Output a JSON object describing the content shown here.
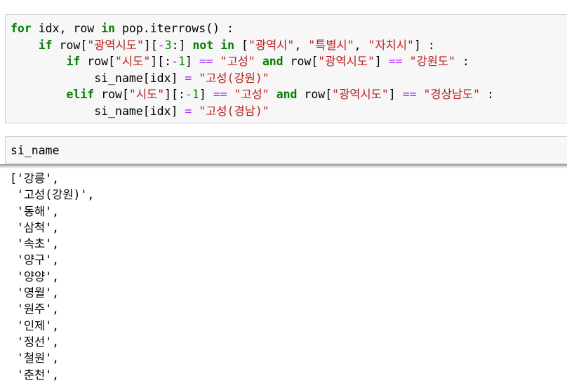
{
  "cell1": {
    "lines": [
      "for idx, row in pop.iterrows() :",
      "    if row[\"광역시도\"][-3:] not in [\"광역시\", \"특별시\", \"자치시\"] :",
      "        if row[\"시도\"][:-1] == \"고성\" and row[\"광역시도\"] == \"강원도\" :",
      "            si_name[idx] = \"고성(강원)\"",
      "        elif row[\"시도\"][:-1] == \"고성\" and row[\"광역시도\"] == \"경상남도\" :",
      "            si_name[idx] = \"고성(경남)\""
    ]
  },
  "cell2": {
    "code": "si_name"
  },
  "output": {
    "lines": [
      "['강릉',",
      " '고성(강원)',",
      " '동해',",
      " '삼척',",
      " '속초',",
      " '양구',",
      " '양양',",
      " '영월',",
      " '원주',",
      " '인제',",
      " '정선',",
      " '철원',",
      " '춘천',"
    ]
  }
}
